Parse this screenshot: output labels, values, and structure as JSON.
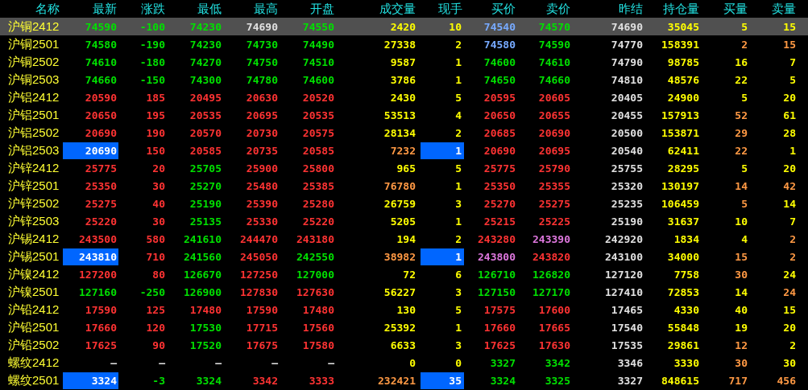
{
  "columns": [
    "名称",
    "最新",
    "涨跌",
    "最低",
    "最高",
    "开盘",
    "成交量",
    "现手",
    "买价",
    "卖价",
    "昨结",
    "持仓量",
    "买量",
    "卖量"
  ],
  "rows": [
    {
      "name": "沪铜2412",
      "selected": true,
      "latest_highlighted": false,
      "hand_highlighted": false,
      "cells": [
        {
          "text": "74590",
          "color": "#00e000"
        },
        {
          "text": "-100",
          "color": "#00e000"
        },
        {
          "text": "74230",
          "color": "#00e000"
        },
        {
          "text": "74690",
          "color": "#e0e0e0"
        },
        {
          "text": "74550",
          "color": "#00e000"
        },
        {
          "text": "2420",
          "color": "#ffff00"
        },
        {
          "text": "10",
          "color": "#ffff00"
        },
        {
          "text": "74540",
          "color": "#77aaff"
        },
        {
          "text": "74570",
          "color": "#00e000"
        },
        {
          "text": "74690",
          "color": "#e0e0e0"
        },
        {
          "text": "35045",
          "color": "#ffff00"
        },
        {
          "text": "5",
          "color": "#ffff00"
        },
        {
          "text": "15",
          "color": "#ffff00"
        }
      ]
    },
    {
      "name": "沪铜2501",
      "selected": false,
      "latest_highlighted": false,
      "hand_highlighted": false,
      "cells": [
        {
          "text": "74580",
          "color": "#00e000"
        },
        {
          "text": "-190",
          "color": "#00e000"
        },
        {
          "text": "74230",
          "color": "#00e000"
        },
        {
          "text": "74730",
          "color": "#00e000"
        },
        {
          "text": "74490",
          "color": "#00e000"
        },
        {
          "text": "27338",
          "color": "#ffff00"
        },
        {
          "text": "2",
          "color": "#ffff00"
        },
        {
          "text": "74580",
          "color": "#77aaff"
        },
        {
          "text": "74590",
          "color": "#00e000"
        },
        {
          "text": "74770",
          "color": "#e0e0e0"
        },
        {
          "text": "158391",
          "color": "#ffff00"
        },
        {
          "text": "2",
          "color": "#ff9944"
        },
        {
          "text": "15",
          "color": "#ff9944"
        }
      ]
    },
    {
      "name": "沪铜2502",
      "selected": false,
      "latest_highlighted": false,
      "hand_highlighted": false,
      "cells": [
        {
          "text": "74610",
          "color": "#00e000"
        },
        {
          "text": "-180",
          "color": "#00e000"
        },
        {
          "text": "74270",
          "color": "#00e000"
        },
        {
          "text": "74750",
          "color": "#00e000"
        },
        {
          "text": "74510",
          "color": "#00e000"
        },
        {
          "text": "9587",
          "color": "#ffff00"
        },
        {
          "text": "1",
          "color": "#ffff00"
        },
        {
          "text": "74600",
          "color": "#00e000"
        },
        {
          "text": "74610",
          "color": "#00e000"
        },
        {
          "text": "74790",
          "color": "#e0e0e0"
        },
        {
          "text": "98785",
          "color": "#ffff00"
        },
        {
          "text": "16",
          "color": "#ffff00"
        },
        {
          "text": "7",
          "color": "#ffff00"
        }
      ]
    },
    {
      "name": "沪铜2503",
      "selected": false,
      "latest_highlighted": false,
      "hand_highlighted": false,
      "cells": [
        {
          "text": "74660",
          "color": "#00e000"
        },
        {
          "text": "-150",
          "color": "#00e000"
        },
        {
          "text": "74300",
          "color": "#00e000"
        },
        {
          "text": "74780",
          "color": "#00e000"
        },
        {
          "text": "74600",
          "color": "#00e000"
        },
        {
          "text": "3786",
          "color": "#ffff00"
        },
        {
          "text": "1",
          "color": "#ffff00"
        },
        {
          "text": "74650",
          "color": "#00e000"
        },
        {
          "text": "74660",
          "color": "#00e000"
        },
        {
          "text": "74810",
          "color": "#e0e0e0"
        },
        {
          "text": "48576",
          "color": "#ffff00"
        },
        {
          "text": "22",
          "color": "#ffff00"
        },
        {
          "text": "5",
          "color": "#ffff00"
        }
      ]
    },
    {
      "name": "沪铝2412",
      "selected": false,
      "latest_highlighted": false,
      "hand_highlighted": false,
      "cells": [
        {
          "text": "20590",
          "color": "#ff3333"
        },
        {
          "text": "185",
          "color": "#ff3333"
        },
        {
          "text": "20495",
          "color": "#ff3333"
        },
        {
          "text": "20630",
          "color": "#ff3333"
        },
        {
          "text": "20520",
          "color": "#ff3333"
        },
        {
          "text": "2430",
          "color": "#ffff00"
        },
        {
          "text": "5",
          "color": "#ffff00"
        },
        {
          "text": "20595",
          "color": "#ff3333"
        },
        {
          "text": "20605",
          "color": "#ff3333"
        },
        {
          "text": "20405",
          "color": "#e0e0e0"
        },
        {
          "text": "24900",
          "color": "#ffff00"
        },
        {
          "text": "5",
          "color": "#ffff00"
        },
        {
          "text": "20",
          "color": "#ffff00"
        }
      ]
    },
    {
      "name": "沪铝2501",
      "selected": false,
      "latest_highlighted": false,
      "hand_highlighted": false,
      "cells": [
        {
          "text": "20650",
          "color": "#ff3333"
        },
        {
          "text": "195",
          "color": "#ff3333"
        },
        {
          "text": "20535",
          "color": "#ff3333"
        },
        {
          "text": "20695",
          "color": "#ff3333"
        },
        {
          "text": "20535",
          "color": "#ff3333"
        },
        {
          "text": "53513",
          "color": "#ffff00"
        },
        {
          "text": "4",
          "color": "#ffff00"
        },
        {
          "text": "20650",
          "color": "#ff3333"
        },
        {
          "text": "20655",
          "color": "#ff3333"
        },
        {
          "text": "20455",
          "color": "#e0e0e0"
        },
        {
          "text": "157913",
          "color": "#ffff00"
        },
        {
          "text": "52",
          "color": "#ff9944"
        },
        {
          "text": "61",
          "color": "#ffff00"
        }
      ]
    },
    {
      "name": "沪铝2502",
      "selected": false,
      "latest_highlighted": false,
      "hand_highlighted": false,
      "cells": [
        {
          "text": "20690",
          "color": "#ff3333"
        },
        {
          "text": "190",
          "color": "#ff3333"
        },
        {
          "text": "20570",
          "color": "#ff3333"
        },
        {
          "text": "20730",
          "color": "#ff3333"
        },
        {
          "text": "20575",
          "color": "#ff3333"
        },
        {
          "text": "28134",
          "color": "#ffff00"
        },
        {
          "text": "2",
          "color": "#ffff00"
        },
        {
          "text": "20685",
          "color": "#ff3333"
        },
        {
          "text": "20690",
          "color": "#ff3333"
        },
        {
          "text": "20500",
          "color": "#e0e0e0"
        },
        {
          "text": "153871",
          "color": "#ffff00"
        },
        {
          "text": "29",
          "color": "#ff9944"
        },
        {
          "text": "28",
          "color": "#ffff00"
        }
      ]
    },
    {
      "name": "沪铝2503",
      "selected": false,
      "latest_highlighted": true,
      "hand_highlighted": true,
      "cells": [
        {
          "text": "20690",
          "color": "#ffffff"
        },
        {
          "text": "150",
          "color": "#ff3333"
        },
        {
          "text": "20585",
          "color": "#ff3333"
        },
        {
          "text": "20735",
          "color": "#ff3333"
        },
        {
          "text": "20585",
          "color": "#ff3333"
        },
        {
          "text": "7232",
          "color": "#ff9944"
        },
        {
          "text": "1",
          "color": "#ffffff"
        },
        {
          "text": "20690",
          "color": "#ff3333"
        },
        {
          "text": "20695",
          "color": "#ff3333"
        },
        {
          "text": "20540",
          "color": "#e0e0e0"
        },
        {
          "text": "62411",
          "color": "#ffff00"
        },
        {
          "text": "22",
          "color": "#ff9944"
        },
        {
          "text": "1",
          "color": "#ffff00"
        }
      ]
    },
    {
      "name": "沪锌2412",
      "selected": false,
      "latest_highlighted": false,
      "hand_highlighted": false,
      "cells": [
        {
          "text": "25775",
          "color": "#ff3333"
        },
        {
          "text": "20",
          "color": "#ff3333"
        },
        {
          "text": "25705",
          "color": "#00e000"
        },
        {
          "text": "25900",
          "color": "#ff3333"
        },
        {
          "text": "25800",
          "color": "#ff3333"
        },
        {
          "text": "965",
          "color": "#ffff00"
        },
        {
          "text": "5",
          "color": "#ffff00"
        },
        {
          "text": "25775",
          "color": "#ff3333"
        },
        {
          "text": "25790",
          "color": "#ff3333"
        },
        {
          "text": "25755",
          "color": "#e0e0e0"
        },
        {
          "text": "28295",
          "color": "#ffff00"
        },
        {
          "text": "5",
          "color": "#ffff00"
        },
        {
          "text": "20",
          "color": "#ffff00"
        }
      ]
    },
    {
      "name": "沪锌2501",
      "selected": false,
      "latest_highlighted": false,
      "hand_highlighted": false,
      "cells": [
        {
          "text": "25350",
          "color": "#ff3333"
        },
        {
          "text": "30",
          "color": "#ff3333"
        },
        {
          "text": "25270",
          "color": "#00e000"
        },
        {
          "text": "25480",
          "color": "#ff3333"
        },
        {
          "text": "25385",
          "color": "#ff3333"
        },
        {
          "text": "76780",
          "color": "#ff9944"
        },
        {
          "text": "1",
          "color": "#ffff00"
        },
        {
          "text": "25350",
          "color": "#ff3333"
        },
        {
          "text": "25355",
          "color": "#ff3333"
        },
        {
          "text": "25320",
          "color": "#e0e0e0"
        },
        {
          "text": "130197",
          "color": "#ffff00"
        },
        {
          "text": "14",
          "color": "#ff9944"
        },
        {
          "text": "42",
          "color": "#ff9944"
        }
      ]
    },
    {
      "name": "沪锌2502",
      "selected": false,
      "latest_highlighted": false,
      "hand_highlighted": false,
      "cells": [
        {
          "text": "25275",
          "color": "#ff3333"
        },
        {
          "text": "40",
          "color": "#ff3333"
        },
        {
          "text": "25190",
          "color": "#00e000"
        },
        {
          "text": "25390",
          "color": "#ff3333"
        },
        {
          "text": "25280",
          "color": "#ff3333"
        },
        {
          "text": "26759",
          "color": "#ffff00"
        },
        {
          "text": "3",
          "color": "#ffff00"
        },
        {
          "text": "25270",
          "color": "#ff3333"
        },
        {
          "text": "25275",
          "color": "#ff3333"
        },
        {
          "text": "25235",
          "color": "#e0e0e0"
        },
        {
          "text": "106459",
          "color": "#ffff00"
        },
        {
          "text": "5",
          "color": "#ff9944"
        },
        {
          "text": "14",
          "color": "#ffff00"
        }
      ]
    },
    {
      "name": "沪锌2503",
      "selected": false,
      "latest_highlighted": false,
      "hand_highlighted": false,
      "cells": [
        {
          "text": "25220",
          "color": "#ff3333"
        },
        {
          "text": "30",
          "color": "#ff3333"
        },
        {
          "text": "25135",
          "color": "#00e000"
        },
        {
          "text": "25330",
          "color": "#ff3333"
        },
        {
          "text": "25220",
          "color": "#ff3333"
        },
        {
          "text": "5205",
          "color": "#ffff00"
        },
        {
          "text": "1",
          "color": "#ffff00"
        },
        {
          "text": "25215",
          "color": "#ff3333"
        },
        {
          "text": "25225",
          "color": "#ff3333"
        },
        {
          "text": "25190",
          "color": "#e0e0e0"
        },
        {
          "text": "31637",
          "color": "#ffff00"
        },
        {
          "text": "10",
          "color": "#ffff00"
        },
        {
          "text": "7",
          "color": "#ffff00"
        }
      ]
    },
    {
      "name": "沪锡2412",
      "selected": false,
      "latest_highlighted": false,
      "hand_highlighted": false,
      "cells": [
        {
          "text": "243500",
          "color": "#ff3333"
        },
        {
          "text": "580",
          "color": "#ff3333"
        },
        {
          "text": "241610",
          "color": "#00e000"
        },
        {
          "text": "244470",
          "color": "#ff3333"
        },
        {
          "text": "243180",
          "color": "#ff3333"
        },
        {
          "text": "194",
          "color": "#ffff00"
        },
        {
          "text": "2",
          "color": "#ffff00"
        },
        {
          "text": "243280",
          "color": "#ff3333"
        },
        {
          "text": "243390",
          "color": "#dd77dd"
        },
        {
          "text": "242920",
          "color": "#e0e0e0"
        },
        {
          "text": "1834",
          "color": "#ffff00"
        },
        {
          "text": "4",
          "color": "#ffff00"
        },
        {
          "text": "2",
          "color": "#ff9944"
        }
      ]
    },
    {
      "name": "沪锡2501",
      "selected": false,
      "latest_highlighted": true,
      "hand_highlighted": true,
      "cells": [
        {
          "text": "243810",
          "color": "#ffffff"
        },
        {
          "text": "710",
          "color": "#ff3333"
        },
        {
          "text": "241560",
          "color": "#00e000"
        },
        {
          "text": "245050",
          "color": "#ff3333"
        },
        {
          "text": "242550",
          "color": "#00e000"
        },
        {
          "text": "38982",
          "color": "#ff9944"
        },
        {
          "text": "1",
          "color": "#ffffff"
        },
        {
          "text": "243800",
          "color": "#dd77dd"
        },
        {
          "text": "243820",
          "color": "#ff3333"
        },
        {
          "text": "243100",
          "color": "#e0e0e0"
        },
        {
          "text": "34000",
          "color": "#ffff00"
        },
        {
          "text": "15",
          "color": "#ff9944"
        },
        {
          "text": "2",
          "color": "#ff9944"
        }
      ]
    },
    {
      "name": "沪镍2412",
      "selected": false,
      "latest_highlighted": false,
      "hand_highlighted": false,
      "cells": [
        {
          "text": "127200",
          "color": "#ff3333"
        },
        {
          "text": "80",
          "color": "#ff3333"
        },
        {
          "text": "126670",
          "color": "#00e000"
        },
        {
          "text": "127250",
          "color": "#ff3333"
        },
        {
          "text": "127000",
          "color": "#00e000"
        },
        {
          "text": "72",
          "color": "#ffff00"
        },
        {
          "text": "6",
          "color": "#ffff00"
        },
        {
          "text": "126710",
          "color": "#00e000"
        },
        {
          "text": "126820",
          "color": "#00e000"
        },
        {
          "text": "127120",
          "color": "#e0e0e0"
        },
        {
          "text": "7758",
          "color": "#ffff00"
        },
        {
          "text": "30",
          "color": "#ff9944"
        },
        {
          "text": "24",
          "color": "#ffff00"
        }
      ]
    },
    {
      "name": "沪镍2501",
      "selected": false,
      "latest_highlighted": false,
      "hand_highlighted": false,
      "cells": [
        {
          "text": "127160",
          "color": "#00e000"
        },
        {
          "text": "-250",
          "color": "#00e000"
        },
        {
          "text": "126900",
          "color": "#00e000"
        },
        {
          "text": "127830",
          "color": "#ff3333"
        },
        {
          "text": "127630",
          "color": "#ff3333"
        },
        {
          "text": "56227",
          "color": "#ffff00"
        },
        {
          "text": "3",
          "color": "#ffff00"
        },
        {
          "text": "127150",
          "color": "#00e000"
        },
        {
          "text": "127170",
          "color": "#00e000"
        },
        {
          "text": "127410",
          "color": "#e0e0e0"
        },
        {
          "text": "72853",
          "color": "#ffff00"
        },
        {
          "text": "14",
          "color": "#ffff00"
        },
        {
          "text": "24",
          "color": "#ff9944"
        }
      ]
    },
    {
      "name": "沪铅2412",
      "selected": false,
      "latest_highlighted": false,
      "hand_highlighted": false,
      "cells": [
        {
          "text": "17590",
          "color": "#ff3333"
        },
        {
          "text": "125",
          "color": "#ff3333"
        },
        {
          "text": "17480",
          "color": "#ff3333"
        },
        {
          "text": "17590",
          "color": "#ff3333"
        },
        {
          "text": "17480",
          "color": "#ff3333"
        },
        {
          "text": "130",
          "color": "#ffff00"
        },
        {
          "text": "5",
          "color": "#ffff00"
        },
        {
          "text": "17575",
          "color": "#ff3333"
        },
        {
          "text": "17600",
          "color": "#ff3333"
        },
        {
          "text": "17465",
          "color": "#e0e0e0"
        },
        {
          "text": "4330",
          "color": "#ffff00"
        },
        {
          "text": "40",
          "color": "#ffff00"
        },
        {
          "text": "15",
          "color": "#ffff00"
        }
      ]
    },
    {
      "name": "沪铅2501",
      "selected": false,
      "latest_highlighted": false,
      "hand_highlighted": false,
      "cells": [
        {
          "text": "17660",
          "color": "#ff3333"
        },
        {
          "text": "120",
          "color": "#ff3333"
        },
        {
          "text": "17530",
          "color": "#00e000"
        },
        {
          "text": "17715",
          "color": "#ff3333"
        },
        {
          "text": "17560",
          "color": "#ff3333"
        },
        {
          "text": "25392",
          "color": "#ffff00"
        },
        {
          "text": "1",
          "color": "#ffff00"
        },
        {
          "text": "17660",
          "color": "#ff3333"
        },
        {
          "text": "17665",
          "color": "#ff3333"
        },
        {
          "text": "17540",
          "color": "#e0e0e0"
        },
        {
          "text": "55848",
          "color": "#ffff00"
        },
        {
          "text": "19",
          "color": "#ffff00"
        },
        {
          "text": "20",
          "color": "#ffff00"
        }
      ]
    },
    {
      "name": "沪铅2502",
      "selected": false,
      "latest_highlighted": false,
      "hand_highlighted": false,
      "cells": [
        {
          "text": "17625",
          "color": "#ff3333"
        },
        {
          "text": "90",
          "color": "#ff3333"
        },
        {
          "text": "17520",
          "color": "#00e000"
        },
        {
          "text": "17675",
          "color": "#ff3333"
        },
        {
          "text": "17580",
          "color": "#ff3333"
        },
        {
          "text": "6633",
          "color": "#ffff00"
        },
        {
          "text": "3",
          "color": "#ffff00"
        },
        {
          "text": "17625",
          "color": "#ff3333"
        },
        {
          "text": "17630",
          "color": "#ff3333"
        },
        {
          "text": "17535",
          "color": "#e0e0e0"
        },
        {
          "text": "29861",
          "color": "#ffff00"
        },
        {
          "text": "12",
          "color": "#ff9944"
        },
        {
          "text": "2",
          "color": "#ffff00"
        }
      ]
    },
    {
      "name": "螺纹2412",
      "selected": false,
      "latest_highlighted": false,
      "hand_highlighted": false,
      "cells": [
        {
          "text": "—",
          "color": "#e0e0e0"
        },
        {
          "text": "—",
          "color": "#e0e0e0"
        },
        {
          "text": "—",
          "color": "#e0e0e0"
        },
        {
          "text": "—",
          "color": "#e0e0e0"
        },
        {
          "text": "—",
          "color": "#e0e0e0"
        },
        {
          "text": "0",
          "color": "#ffff00"
        },
        {
          "text": "0",
          "color": "#ffff00"
        },
        {
          "text": "3327",
          "color": "#00e000"
        },
        {
          "text": "3342",
          "color": "#00e000"
        },
        {
          "text": "3346",
          "color": "#e0e0e0"
        },
        {
          "text": "3330",
          "color": "#ffff00"
        },
        {
          "text": "30",
          "color": "#ff9944"
        },
        {
          "text": "30",
          "color": "#ffff00"
        }
      ]
    },
    {
      "name": "螺纹2501",
      "selected": false,
      "latest_highlighted": true,
      "hand_highlighted": true,
      "cells": [
        {
          "text": "3324",
          "color": "#ffffff"
        },
        {
          "text": "-3",
          "color": "#00e000"
        },
        {
          "text": "3324",
          "color": "#00e000"
        },
        {
          "text": "3342",
          "color": "#ff3333"
        },
        {
          "text": "3333",
          "color": "#ff3333"
        },
        {
          "text": "232421",
          "color": "#ff9944"
        },
        {
          "text": "35",
          "color": "#ffffff"
        },
        {
          "text": "3324",
          "color": "#00e000"
        },
        {
          "text": "3325",
          "color": "#00e000"
        },
        {
          "text": "3327",
          "color": "#e0e0e0"
        },
        {
          "text": "848615",
          "color": "#ffff00"
        },
        {
          "text": "717",
          "color": "#ff9944"
        },
        {
          "text": "456",
          "color": "#ff9944"
        }
      ]
    }
  ]
}
